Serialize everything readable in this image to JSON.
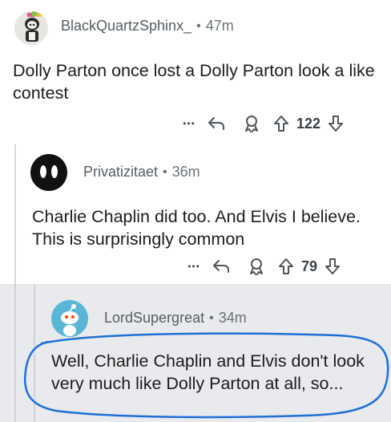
{
  "comments": [
    {
      "username": "BlackQuartzSphinx_",
      "separator": "•",
      "time": "47m",
      "body": "Dolly Parton once lost a Dolly Parton look a like contest",
      "actions": {
        "more": "•••",
        "votes": "122"
      }
    },
    {
      "username": "Privatizitaet",
      "separator": "•",
      "time": "36m",
      "body": "Charlie Chaplin did too. And Elvis I believe. This is surprisingly common",
      "actions": {
        "more": "•••",
        "votes": "79"
      }
    },
    {
      "username": "LordSupergreat",
      "separator": "•",
      "time": "34m",
      "body": "Well, Charlie Chaplin and Elvis don't look very much like Dolly Parton at all, so..."
    }
  ],
  "colors": {
    "highlight_circle": "#1f6fd6",
    "reply_background": "#e8eaed",
    "avatar3": "#5bb6d6"
  }
}
